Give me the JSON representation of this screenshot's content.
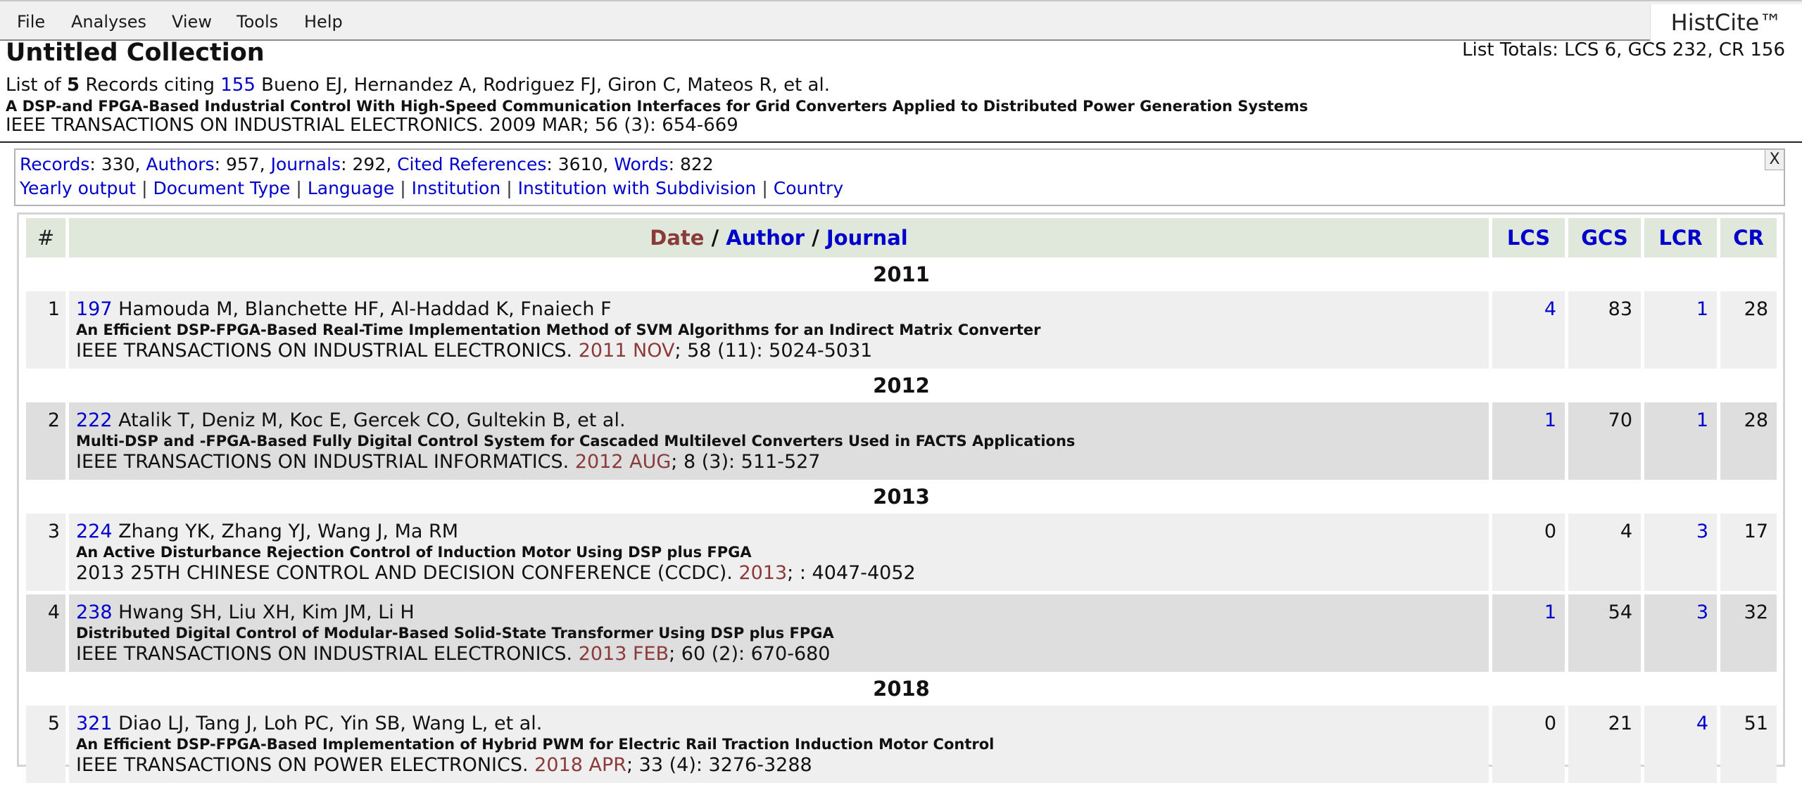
{
  "menu": [
    "File",
    "Analyses",
    "View",
    "Tools",
    "Help"
  ],
  "brand": "HistCite™",
  "collection": {
    "title": "Untitled Collection",
    "totals": "List Totals: LCS 6, GCS 232, CR 156",
    "line1_pre": "List of ",
    "count": "5",
    "line1_mid": " Records citing ",
    "ref_id": "155",
    "line1_authors": " Bueno EJ, Hernandez A, Rodriguez FJ, Giron C, Mateos R, et al.",
    "paper_title": "A DSP-and FPGA-Based Industrial Control With High-Speed Communication Interfaces for Grid Converters Applied to Distributed Power Generation Systems",
    "source": "IEEE TRANSACTIONS ON INDUSTRIAL ELECTRONICS. 2009 MAR; 56 (3): 654-669"
  },
  "stats": {
    "records_label": "Records",
    "records_val": ": 330, ",
    "authors_label": "Authors",
    "authors_val": ": 957, ",
    "journals_label": "Journals",
    "journals_val": ": 292, ",
    "cited_label": "Cited References",
    "cited_val": ": 3610, ",
    "words_label": "Words",
    "words_val": ": 822",
    "links": [
      "Yearly output",
      "Document Type",
      "Language",
      "Institution",
      "Institution with Subdivision",
      "Country"
    ],
    "close": "X"
  },
  "table": {
    "h_num": "#",
    "h_date": "Date",
    "h_slash": " / ",
    "h_author": "Author",
    "h_journal": "Journal",
    "h_lcs": "LCS",
    "h_gcs": "GCS",
    "h_lcr": "LCR",
    "h_cr": "CR"
  },
  "years": [
    "2011",
    "2012",
    "2013",
    "2018"
  ],
  "records": [
    {
      "n": "1",
      "id": "197",
      "authors": " Hamouda M, Blanchette HF, Al-Haddad K, Fnaiech F",
      "title": "An Efficient DSP-FPGA-Based Real-Time Implementation Method of SVM Algorithms for an Indirect Matrix Converter",
      "journal": "IEEE TRANSACTIONS ON INDUSTRIAL ELECTRONICS. ",
      "date": "2011 NOV",
      "rest": "; 58 (11): 5024-5031",
      "lcs": "4",
      "gcs": "83",
      "lcr": "1",
      "cr": "28"
    },
    {
      "n": "2",
      "id": "222",
      "authors": " Atalik T, Deniz M, Koc E, Gercek CO, Gultekin B, et al.",
      "title": "Multi-DSP and -FPGA-Based Fully Digital Control System for Cascaded Multilevel Converters Used in FACTS Applications",
      "journal": "IEEE TRANSACTIONS ON INDUSTRIAL INFORMATICS. ",
      "date": "2012 AUG",
      "rest": "; 8 (3): 511-527",
      "lcs": "1",
      "gcs": "70",
      "lcr": "1",
      "cr": "28"
    },
    {
      "n": "3",
      "id": "224",
      "authors": " Zhang YK, Zhang YJ, Wang J, Ma RM",
      "title": "An Active Disturbance Rejection Control of Induction Motor Using DSP plus FPGA",
      "journal": "2013 25TH CHINESE CONTROL AND DECISION CONFERENCE (CCDC). ",
      "date": "2013",
      "rest": "; : 4047-4052",
      "lcs": "0",
      "gcs": "4",
      "lcr": "3",
      "cr": "17"
    },
    {
      "n": "4",
      "id": "238",
      "authors": " Hwang SH, Liu XH, Kim JM, Li H",
      "title": "Distributed Digital Control of Modular-Based Solid-State Transformer Using DSP plus FPGA",
      "journal": "IEEE TRANSACTIONS ON INDUSTRIAL ELECTRONICS. ",
      "date": "2013 FEB",
      "rest": "; 60 (2): 670-680",
      "lcs": "1",
      "gcs": "54",
      "lcr": "3",
      "cr": "32"
    },
    {
      "n": "5",
      "id": "321",
      "authors": " Diao LJ, Tang J, Loh PC, Yin SB, Wang L, et al.",
      "title": "An Efficient DSP-FPGA-Based Implementation of Hybrid PWM for Electric Rail Traction Induction Motor Control",
      "journal": "IEEE TRANSACTIONS ON POWER ELECTRONICS. ",
      "date": "2018 APR",
      "rest": "; 33 (4): 3276-3288",
      "lcs": "0",
      "gcs": "21",
      "lcr": "4",
      "cr": "51"
    }
  ]
}
